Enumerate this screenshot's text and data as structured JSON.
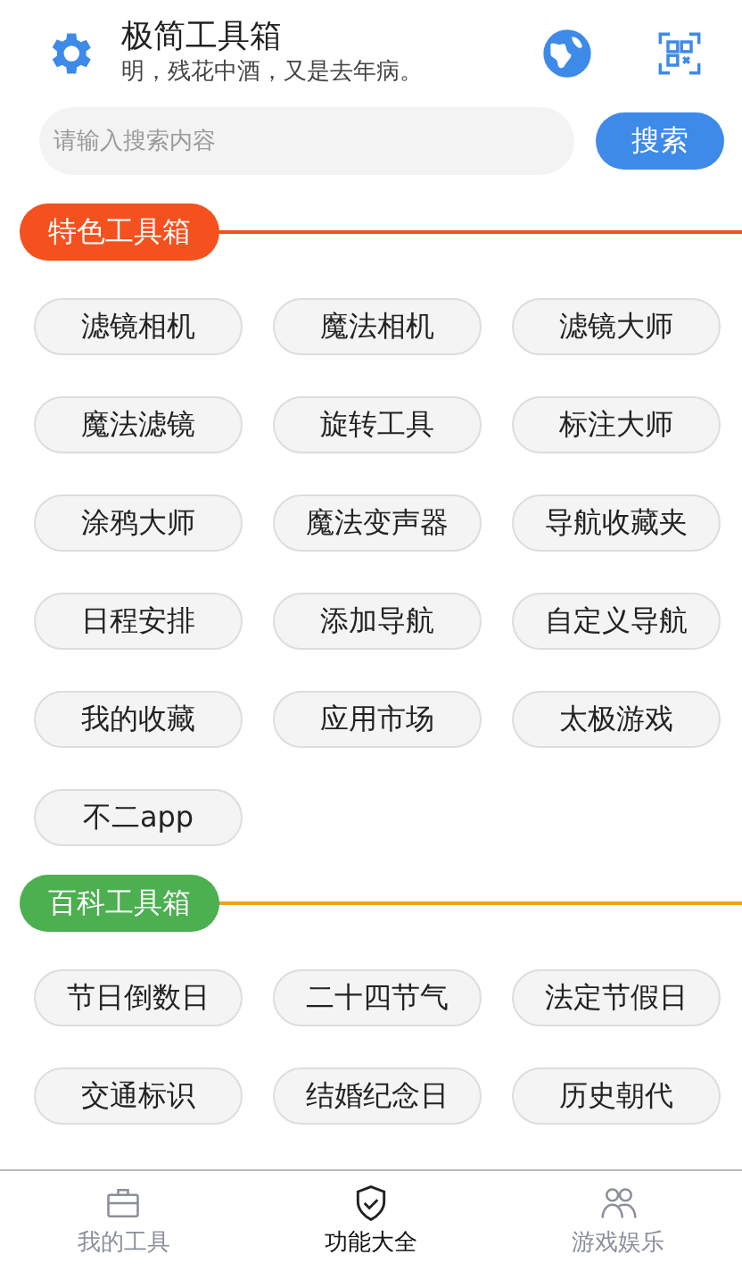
{
  "header": {
    "title": "极简工具箱",
    "subtitle": "明，残花中酒，又是去年病。"
  },
  "search": {
    "placeholder": "请输入搜索内容",
    "button": "搜索"
  },
  "sections": [
    {
      "title": "特色工具箱",
      "color": "#f4511e",
      "rule": {
        "color": "#f4511e"
      },
      "tools": [
        "滤镜相机",
        "魔法相机",
        "滤镜大师",
        "魔法滤镜",
        "旋转工具",
        "标注大师",
        "涂鸦大师",
        "魔法变声器",
        "导航收藏夹",
        "日程安排",
        "添加导航",
        "自定义导航",
        "我的收藏",
        "应用市场",
        "太极游戏",
        "不二app"
      ]
    },
    {
      "title": "百科工具箱",
      "color": "#4caf50",
      "rule": {
        "color": "#f0a020"
      },
      "tools": [
        "节日倒数日",
        "二十四节气",
        "法定节假日",
        "交通标识",
        "结婚纪念日",
        "历史朝代"
      ]
    }
  ],
  "tabs": [
    {
      "label": "我的工具",
      "kind": "briefcase",
      "selected": false
    },
    {
      "label": "功能大全",
      "kind": "shield",
      "selected": true
    },
    {
      "label": "游戏娱乐",
      "kind": "people",
      "selected": false
    }
  ]
}
